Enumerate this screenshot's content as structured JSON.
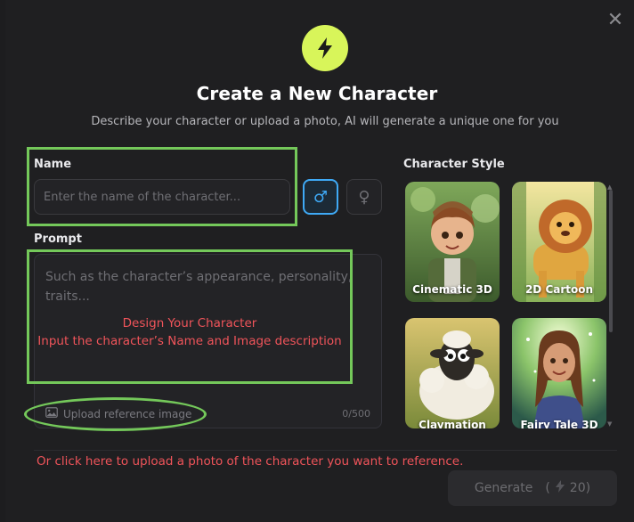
{
  "dialog": {
    "close_icon": "close-icon",
    "badge_icon": "lightning-bolt-icon",
    "accent_color": "#d8f55a",
    "title": "Create a New Character",
    "subtitle": "Describe your character or upload a photo, AI will generate a unique one for you"
  },
  "name_field": {
    "label": "Name",
    "placeholder": "Enter the name of the character...",
    "value": ""
  },
  "gender": {
    "options": [
      {
        "name": "male",
        "icon": "male-symbol-icon",
        "glyph": "♂",
        "selected": true
      },
      {
        "name": "female",
        "icon": "female-symbol-icon",
        "glyph": "♀",
        "selected": false
      }
    ],
    "selected_color": "#3fa9f5"
  },
  "prompt_field": {
    "label": "Prompt",
    "placeholder": "Such as the character’s appearance, personality, traits...",
    "value": "",
    "counter": "0/500",
    "upload_label": "Upload reference image",
    "upload_icon": "image-icon"
  },
  "character_style": {
    "label": "Character Style",
    "styles": [
      {
        "label": "Cinematic 3D"
      },
      {
        "label": "2D Cartoon"
      },
      {
        "label": "Claymation"
      },
      {
        "label": "Fairy Tale 3D"
      }
    ]
  },
  "annotations": {
    "design_line1": "Design Your Character",
    "design_line2": "Input the character’s Name and Image description",
    "upload_hint": "Or click here to upload a photo of the character you want to reference.",
    "highlight_color": "#74c85a",
    "text_color": "#f0545a"
  },
  "generate": {
    "label": "Generate",
    "paren_open": "(",
    "cost": "20)",
    "icon": "lightning-bolt-icon"
  }
}
